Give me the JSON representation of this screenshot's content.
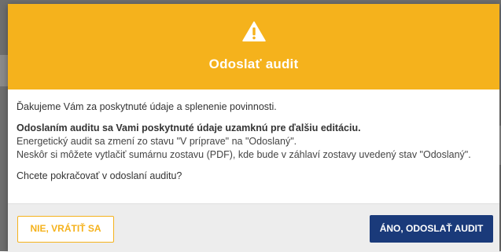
{
  "dialog": {
    "title": "Odoslať audit",
    "icon": "warning-icon",
    "header_color": "#f5b21c",
    "body": {
      "thanks": "Ďakujeme Vám za poskytnuté údaje a splenenie povinnosti.",
      "lock_notice": "Odoslaním auditu sa Vami poskytnuté údaje uzamknú pre ďalšiu editáciu.",
      "status_change": "Energetický audit sa zmení zo stavu \"V príprave\" na \"Odoslaný\".",
      "print_note": "Neskôr si môžete vytlačiť sumárnu zostavu (PDF), kde bude v záhlaví zostavy uvedený stav \"Odoslaný\".",
      "question": "Chcete pokračovať v odoslaní auditu?"
    },
    "buttons": {
      "cancel_label": "NIE, VRÁTIŤ SA",
      "confirm_label": "ÁNO, ODOSLAŤ AUDIT",
      "confirm_color": "#1a3a7a"
    }
  }
}
